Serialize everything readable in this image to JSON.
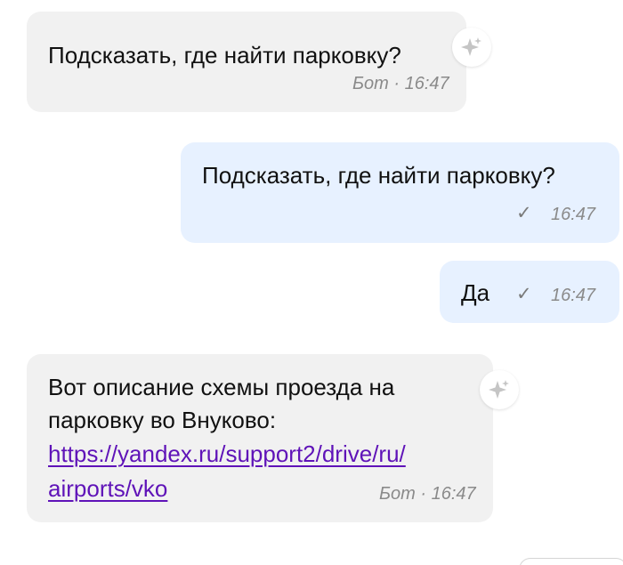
{
  "messages": [
    {
      "sender": "bot",
      "text": "Подсказать, где найти парковку?",
      "meta": "Бот · 16:47"
    },
    {
      "sender": "user",
      "text": "Подсказать, где найти парковку?",
      "time": "16:47"
    },
    {
      "sender": "user",
      "text": "Да",
      "time": "16:47"
    },
    {
      "sender": "bot",
      "text_line1": "Вот описание схемы проезда на",
      "text_line2": "парковку во Внуково:",
      "link_line1": "https://yandex.ru/support2/drive/ru/",
      "link_line2": "airports/vko",
      "meta": "Бот · 16:47"
    }
  ],
  "icons": {
    "sparkle": "sparkle-icon",
    "check": "checkmark-icon"
  },
  "colors": {
    "bot_bubble": "#f1f1f1",
    "user_bubble": "#e7f1ff",
    "link": "#5f13b8",
    "meta": "#8a8a8a"
  }
}
